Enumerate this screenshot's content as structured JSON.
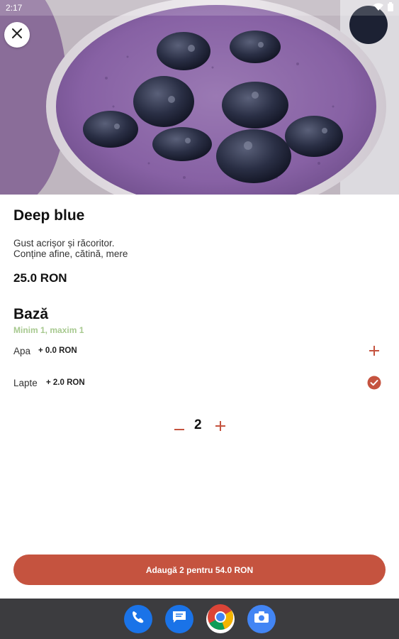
{
  "status_bar": {
    "time": "2:17"
  },
  "product": {
    "name": "Deep blue",
    "description_line1": "Gust acrișor și răcoritor.",
    "description_line2": "Conține afine, cătină, mere",
    "price": "25.0 RON"
  },
  "section": {
    "title": "Bază",
    "subtitle": "Minim 1, maxim 1",
    "options": [
      {
        "name": "Apa",
        "price": "+ 0.0 RON",
        "selected": false,
        "icon": "plus-icon"
      },
      {
        "name": "Lapte",
        "price": "+ 2.0 RON",
        "selected": true,
        "icon": "check-circle-icon"
      }
    ]
  },
  "quantity": {
    "value": "2",
    "minus_icon": "minus-icon",
    "plus_icon": "plus-icon"
  },
  "add_button": {
    "label": "Adaugă 2 pentru 54.0 RON"
  },
  "colors": {
    "accent": "#c5533f",
    "subtitle_green": "#a7c98f",
    "navbar": "#3c3c3f"
  },
  "dock": [
    {
      "name": "phone-icon",
      "color": "#1a73e8"
    },
    {
      "name": "messages-icon",
      "color": "#1a73e8"
    },
    {
      "name": "chrome-icon",
      "color": "#34a853"
    },
    {
      "name": "camera-icon",
      "color": "#4285f4"
    }
  ]
}
